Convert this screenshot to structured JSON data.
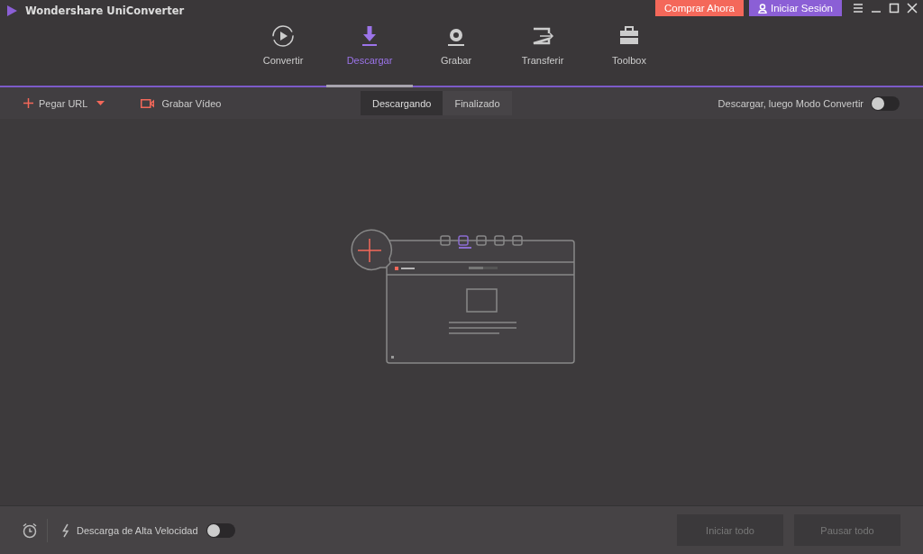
{
  "window": {
    "title": "Wondershare UniConverter"
  },
  "header_buttons": [
    {
      "label": "Comprar Ahora",
      "kind": "buy"
    },
    {
      "label": "Iniciar Sesión",
      "kind": "login"
    }
  ],
  "nav_tabs": [
    {
      "label": "Convertir",
      "kind": "convert",
      "selected": false
    },
    {
      "label": "Descargar",
      "kind": "download",
      "selected": true
    },
    {
      "label": "Grabar",
      "kind": "record",
      "selected": false
    },
    {
      "label": "Transferir",
      "kind": "transfer",
      "selected": false
    },
    {
      "label": "Toolbox",
      "kind": "toolbox",
      "selected": false
    }
  ],
  "toolbar": {
    "paste_url": "Pegar URL",
    "record_video": "Grabar Vídeo",
    "segments": [
      {
        "label": "Descargando",
        "selected": true
      },
      {
        "label": "Finalizado",
        "selected": false
      }
    ],
    "convert_toggle": {
      "label": "Descargar, luego Modo Convertir",
      "on": false
    }
  },
  "footer": {
    "speed_toggle": {
      "label": "Descarga de Alta Velocidad",
      "on": false
    },
    "buttons": [
      {
        "label": "Iniciar todo",
        "disabled": true
      },
      {
        "label": "Pausar todo",
        "disabled": true
      }
    ]
  }
}
